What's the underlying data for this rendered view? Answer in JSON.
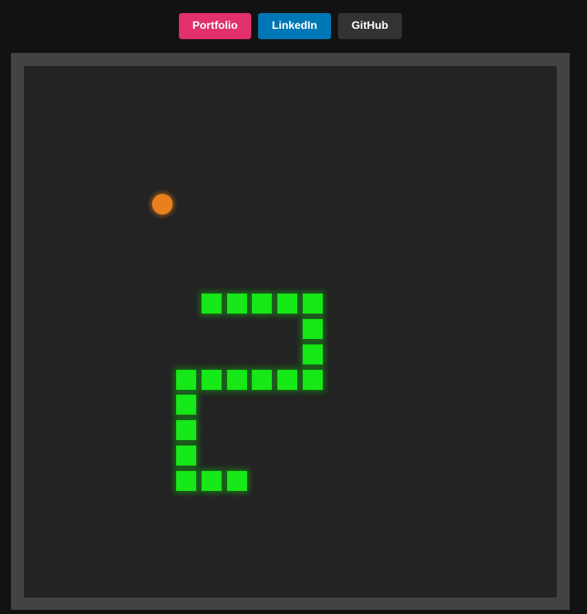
{
  "nav": {
    "portfolio": {
      "label": "Portfolio",
      "color": "#e1306c"
    },
    "linkedin": {
      "label": "LinkedIn",
      "color": "#0077b5"
    },
    "github": {
      "label": "GitHub",
      "color": "#333333"
    }
  },
  "game": {
    "board_color": "#232323",
    "frame_color": "#434343",
    "food": {
      "color": "#e8801e",
      "cell": [
        6,
        5
      ]
    },
    "snake": {
      "color": "#17e817",
      "segments": [
        [
          8,
          9
        ],
        [
          9,
          9
        ],
        [
          10,
          9
        ],
        [
          11,
          9
        ],
        [
          12,
          9
        ],
        [
          12,
          10
        ],
        [
          12,
          11
        ],
        [
          12,
          12
        ],
        [
          11,
          12
        ],
        [
          10,
          12
        ],
        [
          9,
          12
        ],
        [
          8,
          12
        ],
        [
          7,
          12
        ],
        [
          7,
          13
        ],
        [
          7,
          14
        ],
        [
          7,
          15
        ],
        [
          7,
          16
        ],
        [
          8,
          16
        ],
        [
          9,
          16
        ]
      ]
    }
  }
}
